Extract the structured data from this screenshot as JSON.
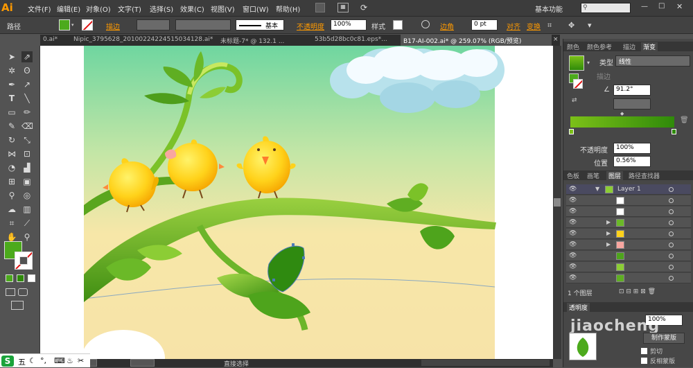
{
  "app": {
    "logo": "Ai"
  },
  "menu": [
    "文件(F)",
    "编辑(E)",
    "对象(O)",
    "文字(T)",
    "选择(S)",
    "效果(C)",
    "视图(V)",
    "窗口(W)",
    "帮助(H)"
  ],
  "workspace": {
    "label": "基本功能",
    "search_placeholder": ""
  },
  "control": {
    "object_label": "路径",
    "stroke_label": "描边",
    "stroke_style": "基本",
    "opacity_label": "不透明度",
    "opacity_value": "100%",
    "style_label": "样式",
    "corner_label": "边角",
    "corner_value": "0 pt",
    "align_label": "对齐",
    "transform_label": "变换"
  },
  "tabs": [
    {
      "label": "0.ai*",
      "active": false
    },
    {
      "label": "Nipic_3795628_20100224224515034128.ai*",
      "active": false
    },
    {
      "label": "未标题-7* @ 132.1 ...",
      "active": false
    },
    {
      "label": "53b5d28bc0c81.eps*...",
      "active": false
    },
    {
      "label": "B17-AI-002.ai* @ 259.07% (RGB/预览)",
      "active": true
    }
  ],
  "gradient_panel": {
    "tabs": [
      "颜色",
      "颜色参考",
      "描边",
      "渐变"
    ],
    "type_label": "类型",
    "type_value": "线性",
    "stroke_label": "描边",
    "angle_value": "91.2°",
    "opacity_label": "不透明度",
    "opacity_value": "100%",
    "position_label": "位置",
    "position_value": "0.56%",
    "start_color": "#7cc018",
    "end_color": "#2f8a0a"
  },
  "layers_panel": {
    "tabs": [
      "色板",
      "画笔",
      "图层",
      "路径查找器"
    ],
    "layer_name": "Layer 1",
    "count_label": "1 个图层"
  },
  "transparency_panel": {
    "tab": "透明度",
    "opacity_value": "100%",
    "make_mask": "制作蒙版",
    "clip": "剪切",
    "invert": "反相蒙版"
  },
  "status": {
    "zoom": "",
    "tool": "直接选择"
  },
  "watermark": "jiaocheng",
  "colors": {
    "fill": "#4caa1c",
    "sky_top": "#6fd6a0",
    "sky_bottom": "#f7e7a8",
    "branch": "#6cb52a",
    "chick": "#ffc40f",
    "accent": "#ff9a00"
  }
}
